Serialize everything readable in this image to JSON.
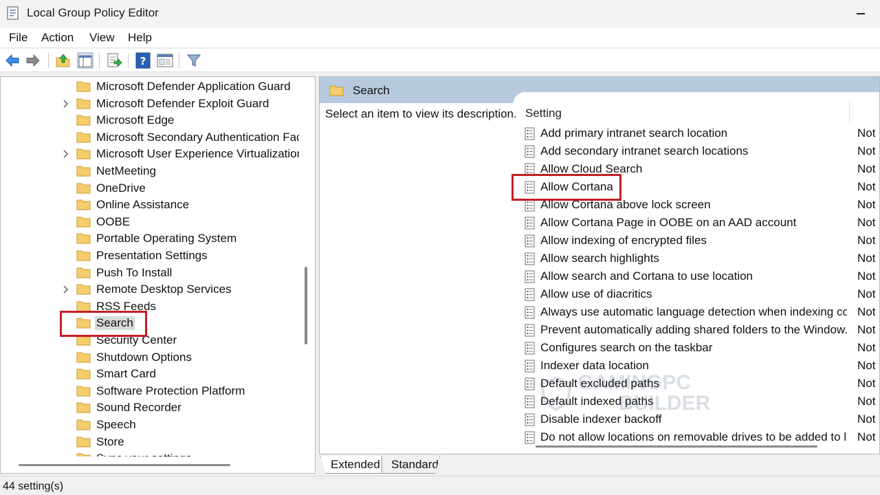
{
  "window": {
    "title": "Local Group Policy Editor",
    "minimize_glyph": "—"
  },
  "menu": [
    "File",
    "Action",
    "View",
    "Help"
  ],
  "toolbar": {
    "buttons": [
      "back-arrow-icon",
      "forward-arrow-icon",
      "up-folder-icon",
      "show-hide-tree-icon",
      "export-list-icon",
      "help-icon",
      "properties-icon",
      "filter-icon"
    ]
  },
  "tree": {
    "items": [
      {
        "label": "Microsoft Defender Application Guard",
        "expandable": false
      },
      {
        "label": "Microsoft Defender Exploit Guard",
        "expandable": true
      },
      {
        "label": "Microsoft Edge",
        "expandable": false
      },
      {
        "label": "Microsoft Secondary Authentication Fact",
        "expandable": false
      },
      {
        "label": "Microsoft User Experience Virtualization",
        "expandable": true
      },
      {
        "label": "NetMeeting",
        "expandable": false
      },
      {
        "label": "OneDrive",
        "expandable": false
      },
      {
        "label": "Online Assistance",
        "expandable": false
      },
      {
        "label": "OOBE",
        "expandable": false
      },
      {
        "label": "Portable Operating System",
        "expandable": false
      },
      {
        "label": "Presentation Settings",
        "expandable": false
      },
      {
        "label": "Push To Install",
        "expandable": false
      },
      {
        "label": "Remote Desktop Services",
        "expandable": true
      },
      {
        "label": "RSS Feeds",
        "expandable": false
      },
      {
        "label": "Search",
        "expandable": false,
        "selected": true
      },
      {
        "label": "Security Center",
        "expandable": false
      },
      {
        "label": "Shutdown Options",
        "expandable": false
      },
      {
        "label": "Smart Card",
        "expandable": false
      },
      {
        "label": "Software Protection Platform",
        "expandable": false
      },
      {
        "label": "Sound Recorder",
        "expandable": false
      },
      {
        "label": "Speech",
        "expandable": false
      },
      {
        "label": "Store",
        "expandable": false
      },
      {
        "label": "Sync your settings",
        "expandable": false
      }
    ]
  },
  "right": {
    "folder_title": "Search",
    "description": "Select an item to view its description.",
    "column_setting": "Setting",
    "settings": [
      {
        "name": "Add primary intranet search location",
        "state": "Not"
      },
      {
        "name": "Add secondary intranet search locations",
        "state": "Not"
      },
      {
        "name": "Allow Cloud Search",
        "state": "Not"
      },
      {
        "name": "Allow Cortana",
        "state": "Not",
        "highlighted": true
      },
      {
        "name": "Allow Cortana above lock screen",
        "state": "Not"
      },
      {
        "name": "Allow Cortana Page in OOBE on an AAD account",
        "state": "Not"
      },
      {
        "name": "Allow indexing of encrypted files",
        "state": "Not"
      },
      {
        "name": "Allow search highlights",
        "state": "Not"
      },
      {
        "name": "Allow search and Cortana to use location",
        "state": "Not"
      },
      {
        "name": "Allow use of diacritics",
        "state": "Not"
      },
      {
        "name": "Always use automatic language detection when indexing co...",
        "state": "Not"
      },
      {
        "name": "Prevent automatically adding shared folders to the Window...",
        "state": "Not"
      },
      {
        "name": "Configures search on the taskbar",
        "state": "Not"
      },
      {
        "name": "Indexer data location",
        "state": "Not"
      },
      {
        "name": "Default excluded paths",
        "state": "Not"
      },
      {
        "name": "Default indexed paths",
        "state": "Not"
      },
      {
        "name": "Disable indexer backoff",
        "state": "Not"
      },
      {
        "name": "Do not allow locations on removable drives to be added to li...",
        "state": "Not"
      }
    ]
  },
  "tabs": [
    "Extended",
    "Standard"
  ],
  "watermark": {
    "line1": "GAMINGPC",
    "line2": "BUILDER"
  },
  "status": "44 setting(s)",
  "colors": {
    "highlight_box": "#c11f25",
    "header_band": "#b7c9dd",
    "folder": "#f5cd6b"
  }
}
